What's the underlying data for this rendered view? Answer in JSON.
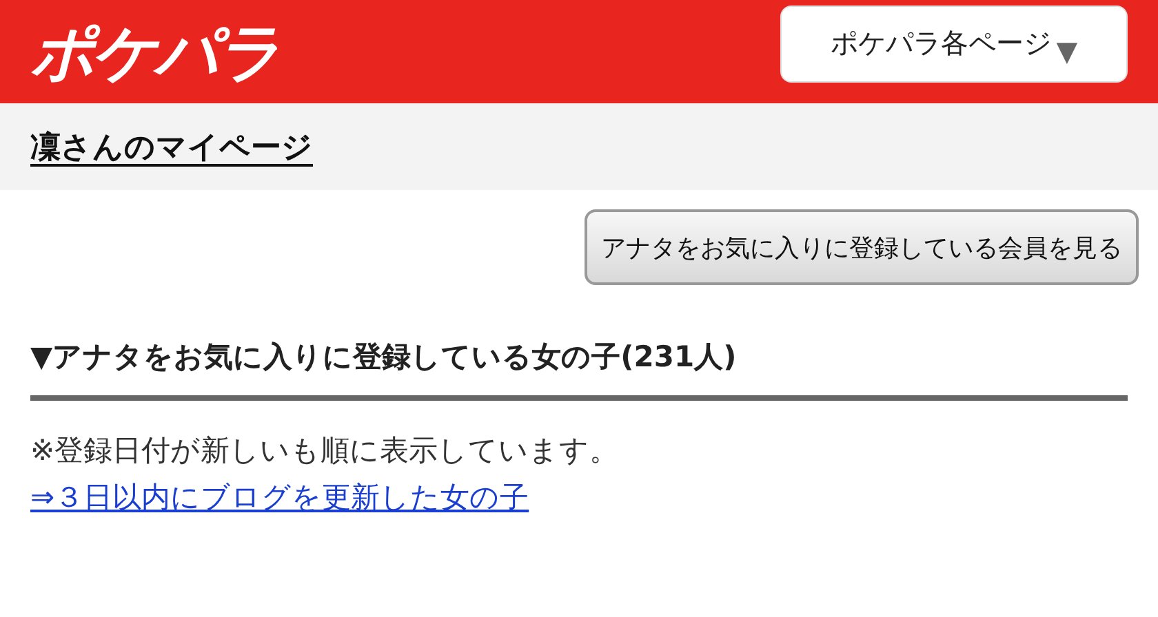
{
  "header": {
    "logo": "ポケパラ",
    "menu_button": {
      "label": "ポケパラ各ページ",
      "caret": "▼"
    }
  },
  "page_title": "凜さんのマイページ",
  "action_button": "アナタをお気に入りに登録している会員を見る",
  "section": {
    "heading": "▼アナタをお気に入りに登録している女の子(231人)",
    "note": "※登録日付が新しいも順に表示しています。",
    "link": "⇒３日以内にブログを更新した女の子"
  }
}
